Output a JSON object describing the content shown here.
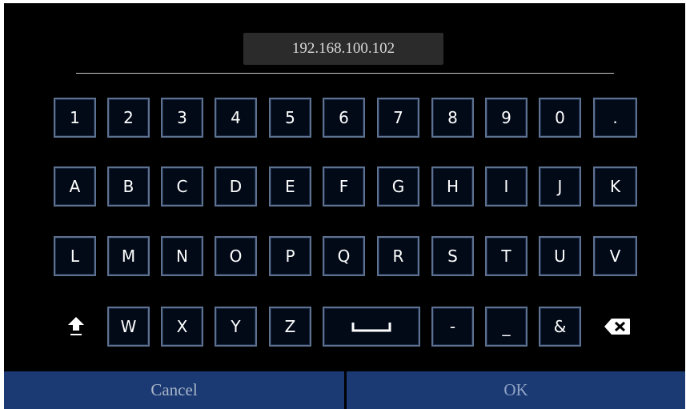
{
  "input": {
    "value": "192.168.100.102"
  },
  "keys": {
    "row1": [
      "1",
      "2",
      "3",
      "4",
      "5",
      "6",
      "7",
      "8",
      "9",
      "0",
      "."
    ],
    "row2": [
      "A",
      "B",
      "C",
      "D",
      "E",
      "F",
      "G",
      "H",
      "I",
      "J",
      "K"
    ],
    "row3": [
      "L",
      "M",
      "N",
      "O",
      "P",
      "Q",
      "R",
      "S",
      "T",
      "U",
      "V"
    ],
    "row4": [
      "W",
      "X",
      "Y",
      "Z",
      "-",
      "_",
      "&"
    ]
  },
  "icons": {
    "shift": "shift-icon",
    "space": "space-bar-icon",
    "backspace": "backspace-icon"
  },
  "buttons": {
    "cancel": "Cancel",
    "ok": "OK"
  },
  "colors": {
    "background": "#000000",
    "key_fill": "#020a18",
    "key_border": "#5d7190",
    "bottom_bar": "#1b3a73",
    "input_box": "#2b2b2b"
  }
}
